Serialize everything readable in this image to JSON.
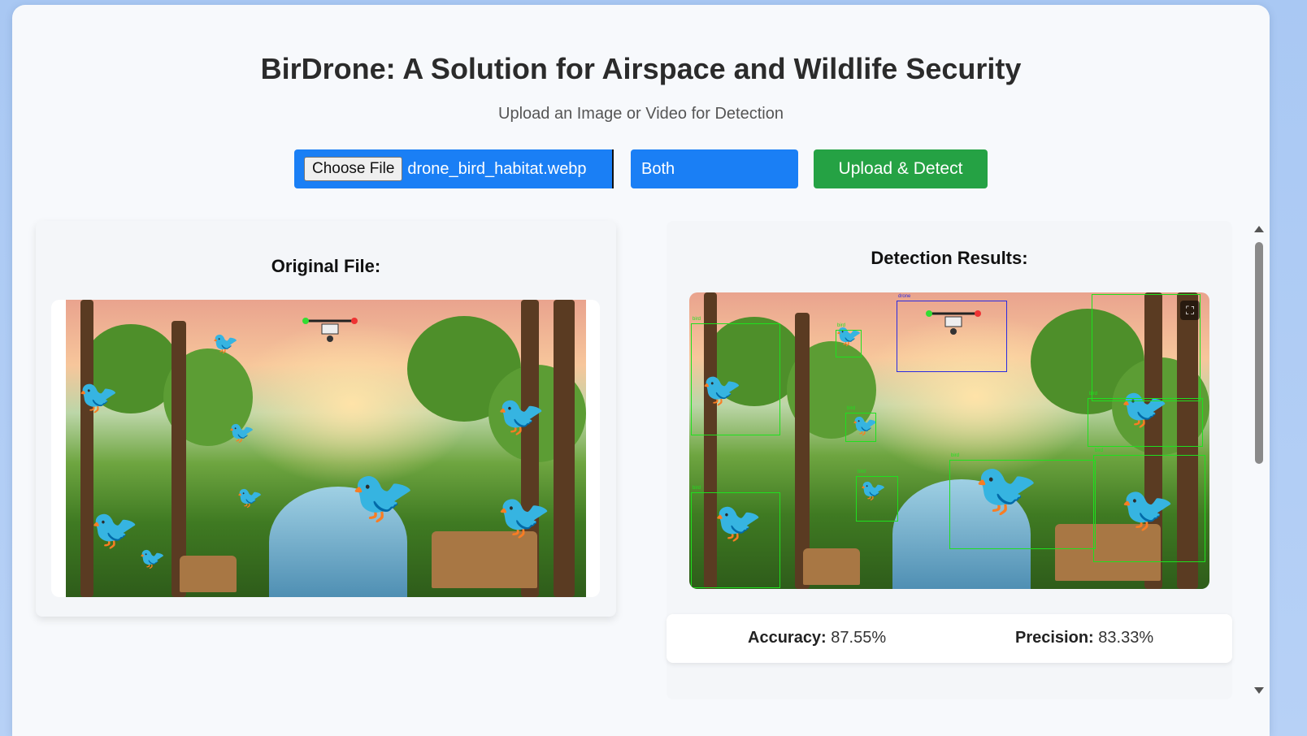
{
  "header": {
    "title": "BirDrone: A Solution for Airspace and Wildlife Security",
    "subtitle": "Upload an Image or Video for Detection"
  },
  "controls": {
    "choose_file_label": "Choose File",
    "file_name": "drone_bird_habitat.webp",
    "mode_selected": "Both",
    "upload_button_label": "Upload & Detect"
  },
  "original_panel": {
    "title": "Original File:"
  },
  "results_panel": {
    "title": "Detection Results:",
    "fullscreen_icon": "fullscreen-icon",
    "detections": [
      {
        "label": "drone"
      },
      {
        "label": "bird"
      },
      {
        "label": "bird"
      },
      {
        "label": "bird"
      },
      {
        "label": "bird"
      },
      {
        "label": "bird"
      },
      {
        "label": "bird"
      },
      {
        "label": "bird"
      },
      {
        "label": "bird"
      },
      {
        "label": "bird"
      }
    ],
    "metrics": {
      "accuracy_label": "Accuracy:",
      "accuracy_value": "87.55%",
      "precision_label": "Precision:",
      "precision_value": "83.33%"
    }
  },
  "colors": {
    "primary_blue": "#1a7ff5",
    "success_green": "#25a244",
    "bird_box": "#1fe01f",
    "drone_box": "#2a2ae0"
  }
}
